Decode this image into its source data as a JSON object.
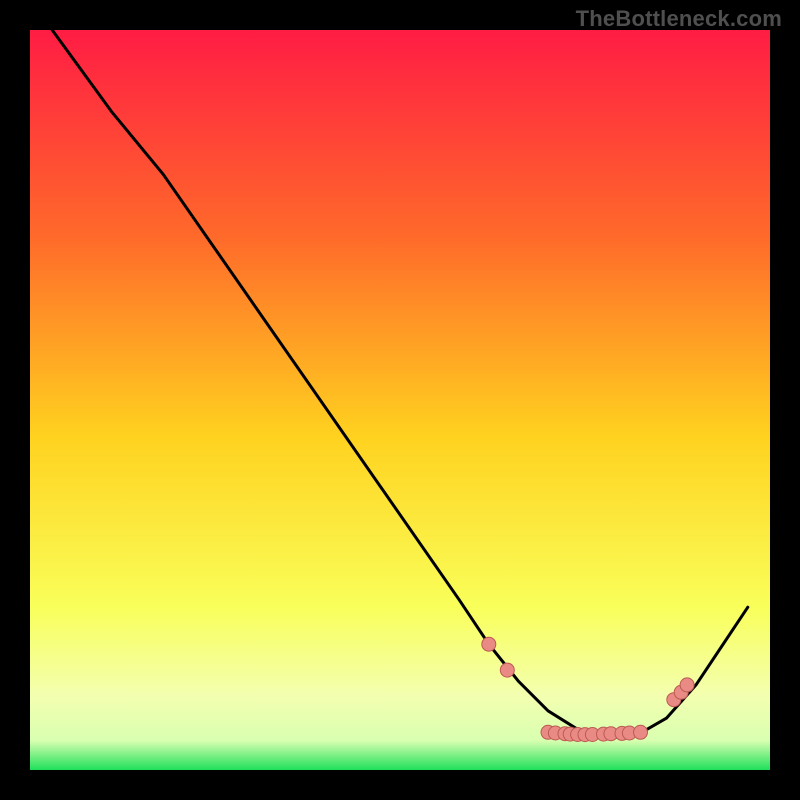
{
  "watermark": "TheBottleneck.com",
  "colors": {
    "bg": "#000000",
    "grad_top": "#ff1c44",
    "grad_mid_upper": "#ff6a2a",
    "grad_mid": "#ffd21f",
    "grad_lower": "#f9ff5a",
    "grad_pale": "#f3ffb0",
    "grad_green": "#1fe05a",
    "curve": "#000000",
    "marker_fill": "#e98b84",
    "marker_stroke": "#bb5a53"
  },
  "chart_data": {
    "type": "line",
    "title": "",
    "xlabel": "",
    "ylabel": "",
    "xlim": [
      0,
      100
    ],
    "ylim": [
      0,
      100
    ],
    "curve": [
      {
        "x": 3,
        "y": 100
      },
      {
        "x": 11,
        "y": 89
      },
      {
        "x": 18,
        "y": 80.5
      },
      {
        "x": 58,
        "y": 23
      },
      {
        "x": 62,
        "y": 17
      },
      {
        "x": 66,
        "y": 12
      },
      {
        "x": 70,
        "y": 8
      },
      {
        "x": 74,
        "y": 5.5
      },
      {
        "x": 78,
        "y": 4.3
      },
      {
        "x": 82,
        "y": 4.7
      },
      {
        "x": 86,
        "y": 7
      },
      {
        "x": 90,
        "y": 11.5
      },
      {
        "x": 94,
        "y": 17.5
      },
      {
        "x": 97,
        "y": 22
      }
    ],
    "markers": [
      {
        "x": 62.0,
        "y": 17.0
      },
      {
        "x": 64.5,
        "y": 13.5
      },
      {
        "x": 70.0,
        "y": 5.1
      },
      {
        "x": 71.0,
        "y": 5.0
      },
      {
        "x": 72.3,
        "y": 4.9
      },
      {
        "x": 73.0,
        "y": 4.85
      },
      {
        "x": 74.0,
        "y": 4.8
      },
      {
        "x": 75.0,
        "y": 4.78
      },
      {
        "x": 76.0,
        "y": 4.8
      },
      {
        "x": 77.5,
        "y": 4.85
      },
      {
        "x": 78.5,
        "y": 4.9
      },
      {
        "x": 80.0,
        "y": 4.95
      },
      {
        "x": 81.0,
        "y": 5.0
      },
      {
        "x": 82.5,
        "y": 5.1
      },
      {
        "x": 87.0,
        "y": 9.5
      },
      {
        "x": 88.0,
        "y": 10.5
      },
      {
        "x": 88.8,
        "y": 11.5
      }
    ]
  }
}
